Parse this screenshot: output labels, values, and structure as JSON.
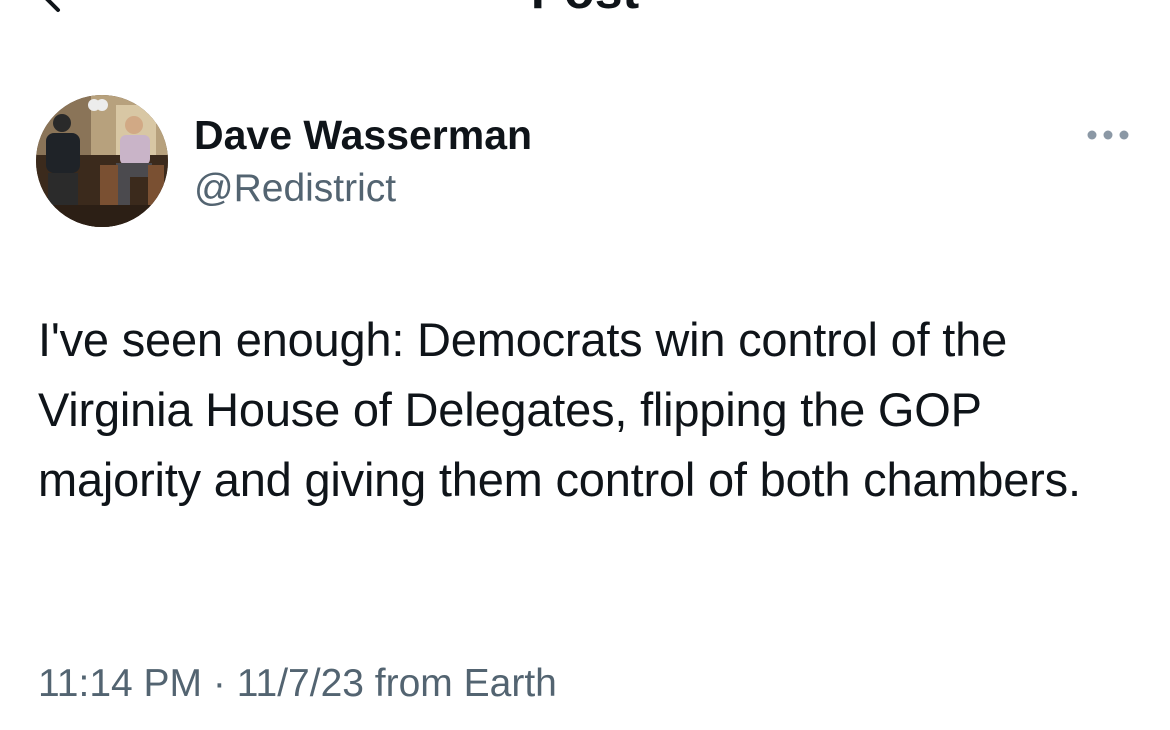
{
  "header": {
    "title": "Post",
    "back_icon": "chevron-left-icon"
  },
  "tweet": {
    "author": {
      "display_name": "Dave Wasserman",
      "handle": "@Redistrict",
      "avatar": "avatar-photo"
    },
    "more_icon": "more-horizontal-icon",
    "text": "I've seen enough: Democrats win control of the Virginia House of Delegates, flipping the GOP majority and giving them control of both chambers.",
    "time": "11:14 PM",
    "separator": " · ",
    "date": "11/7/23",
    "source": " from Earth"
  },
  "colors": {
    "text_primary": "#0f1419",
    "text_secondary": "#536471",
    "more_dots": "#8b98a5",
    "background": "#ffffff"
  }
}
